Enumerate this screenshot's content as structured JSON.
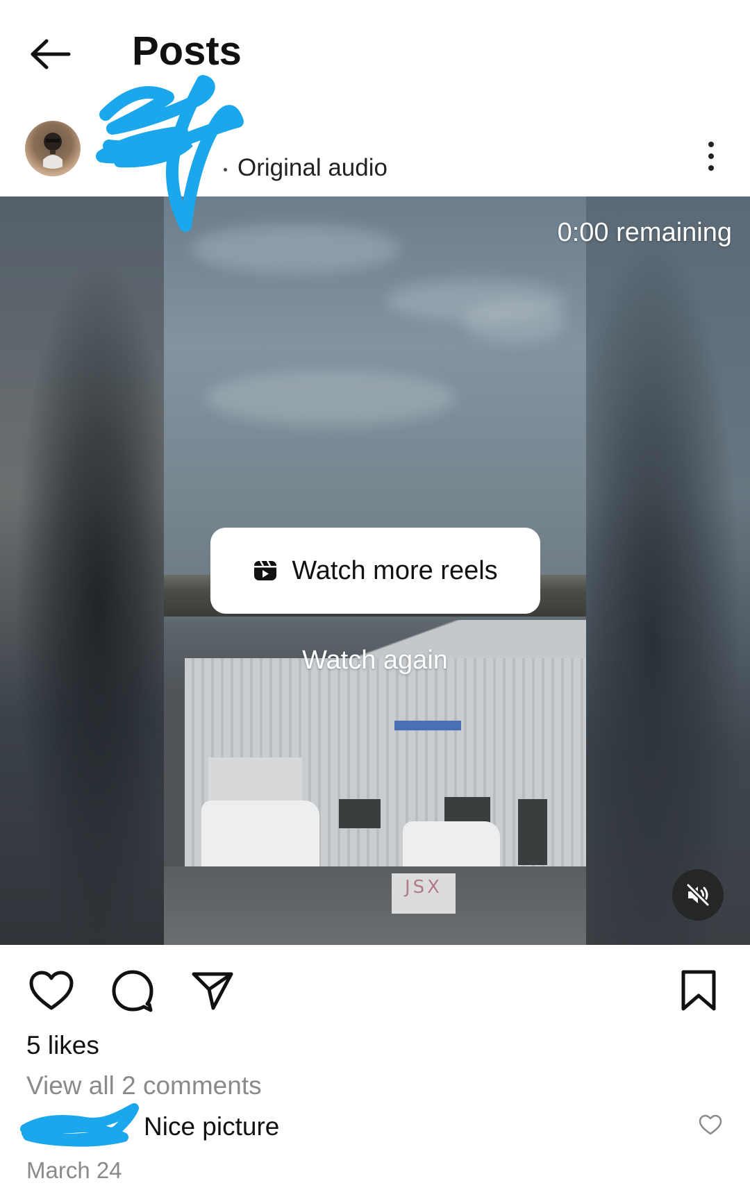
{
  "header": {
    "title": "Posts",
    "back_icon": "arrow-left-icon"
  },
  "post": {
    "audio_label": "Original audio",
    "more_icon": "more-vertical-icon",
    "video": {
      "remaining": "0:00 remaining",
      "watch_more_label": "Watch more reels",
      "watch_again_label": "Watch again",
      "sign_text": "JSX",
      "mute_icon": "speaker-muted-icon"
    },
    "actions": {
      "like_icon": "heart-icon",
      "comment_icon": "comment-bubble-icon",
      "share_icon": "paper-plane-icon",
      "save_icon": "bookmark-icon"
    },
    "likes_text": "5 likes",
    "view_comments_text": "View all 2 comments",
    "comment": {
      "text": "Nice picture",
      "like_icon": "heart-outline-icon"
    },
    "date": "March 24"
  },
  "colors": {
    "text": "#111111",
    "muted": "#8a8a8a",
    "redaction": "#1aa7ec",
    "mute_button_bg": "#262626"
  }
}
